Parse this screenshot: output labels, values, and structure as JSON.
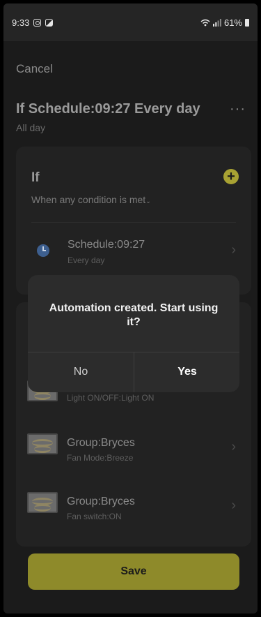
{
  "status_bar": {
    "time": "9:33",
    "battery": "61%"
  },
  "header": {
    "cancel": "Cancel",
    "title": "If Schedule:09:27 Every day",
    "subtitle": "All day",
    "more": "···"
  },
  "if_card": {
    "label": "If",
    "condition_mode": "When any condition is met",
    "condition": {
      "title": "Schedule:09:27",
      "subtitle": "Every day"
    }
  },
  "then_card": {
    "actions": [
      {
        "title": "",
        "subtitle": "Light ON/OFF:Light ON"
      },
      {
        "title": "Group:Bryces",
        "subtitle": "Fan Mode:Breeze"
      },
      {
        "title": "Group:Bryces",
        "subtitle": "Fan switch:ON"
      }
    ]
  },
  "save_label": "Save",
  "dialog": {
    "message": "Automation created. Start using it?",
    "no_label": "No",
    "yes_label": "Yes"
  },
  "colors": {
    "accent": "#a8a233",
    "background": "#1b1b1b",
    "card": "#222222",
    "dialog": "#2c2c2c"
  }
}
